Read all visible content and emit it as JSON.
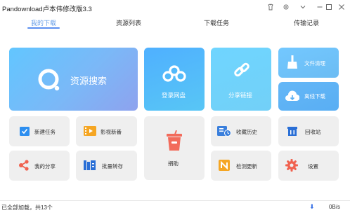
{
  "window": {
    "title": "Pandownload卢本伟修改版3.3"
  },
  "tabs": [
    {
      "label": "我的下载",
      "active": true
    },
    {
      "label": "资源列表",
      "active": false
    },
    {
      "label": "下载任务",
      "active": false
    },
    {
      "label": "传输记录",
      "active": false
    }
  ],
  "tiles": {
    "search": {
      "label": "资源搜索"
    },
    "login": {
      "label": "登录网盘"
    },
    "share_link": {
      "label": "分享链接"
    },
    "file_clean": {
      "label": "文件清理"
    },
    "offline_download": {
      "label": "离线下载"
    },
    "new_task": {
      "label": "新建任务"
    },
    "movies": {
      "label": "影视新番"
    },
    "donate": {
      "label": "捐助"
    },
    "favorites": {
      "label": "收藏历史"
    },
    "recycle": {
      "label": "回收站"
    },
    "my_share": {
      "label": "我的分享"
    },
    "batch_transfer": {
      "label": "批量转存"
    },
    "check_update": {
      "label": "检测更新"
    },
    "settings": {
      "label": "设置"
    }
  },
  "status": {
    "left": "已全部加载，共13个",
    "speed": "0B/s"
  },
  "colors": {
    "accent": "#5b8ff0",
    "tile_blue_light": "#6ec8ff",
    "tile_gray": "#efefef"
  }
}
